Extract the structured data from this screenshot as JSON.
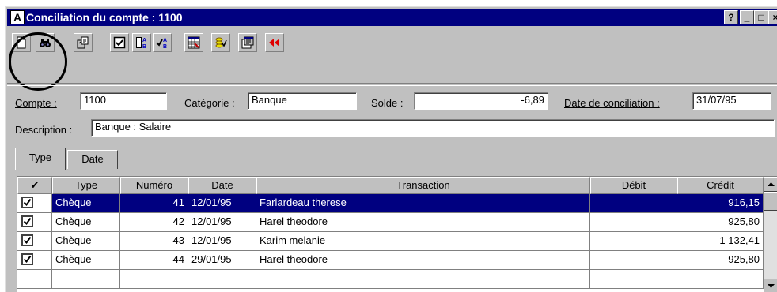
{
  "window": {
    "app_icon_letter": "A",
    "title": "Conciliation du compte : 1100",
    "controls": {
      "help": "?",
      "minimize": "_",
      "maximize": "□",
      "close": "×"
    }
  },
  "toolbar": {
    "buttons": [
      "new-document-icon",
      "binoculars-icon",
      "clipboard-icon",
      "checkbox-icon",
      "sort-ab-icon",
      "check-sort-ab-icon",
      "spreadsheet-icon",
      "coins-check-icon",
      "properties-icon",
      "rewind-icon"
    ]
  },
  "form": {
    "compte_label": "Compte :",
    "compte_value": "1100",
    "categorie_label": "Catégorie :",
    "categorie_value": "Banque",
    "solde_label": "Solde :",
    "solde_value": "-6,89",
    "date_label": "Date de conciliation :",
    "date_value": "31/07/95",
    "description_label": "Description :",
    "description_value": "Banque : Salaire"
  },
  "tabs": [
    "Type",
    "Date"
  ],
  "table": {
    "check_header": "✔",
    "columns": [
      "Type",
      "Numéro",
      "Date",
      "Transaction",
      "Débit",
      "Crédit"
    ],
    "rows": [
      {
        "checked": true,
        "type": "Chèque",
        "numero": "41",
        "date": "12/01/95",
        "transaction": "Farlardeau therese",
        "debit": "",
        "credit": "916,15",
        "selected": true
      },
      {
        "checked": true,
        "type": "Chèque",
        "numero": "42",
        "date": "12/01/95",
        "transaction": "Harel theodore",
        "debit": "",
        "credit": "925,80",
        "selected": false
      },
      {
        "checked": true,
        "type": "Chèque",
        "numero": "43",
        "date": "12/01/95",
        "transaction": "Karim melanie",
        "debit": "",
        "credit": "1 132,41",
        "selected": false
      },
      {
        "checked": true,
        "type": "Chèque",
        "numero": "44",
        "date": "29/01/95",
        "transaction": "Harel theodore",
        "debit": "",
        "credit": "925,80",
        "selected": false
      }
    ]
  },
  "colors": {
    "titlebar": "#000080",
    "selection": "#000080",
    "rewind": "#e00000"
  }
}
